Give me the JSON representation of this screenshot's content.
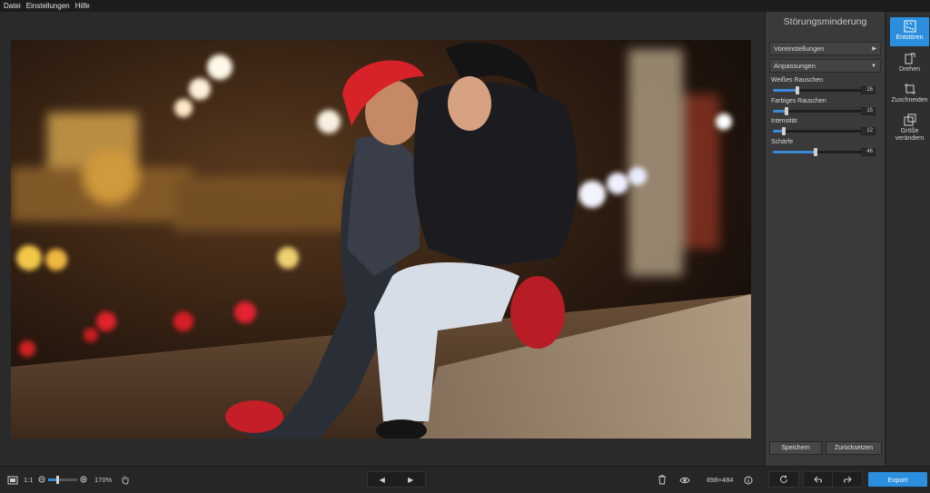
{
  "menu": {
    "file": "Datei",
    "settings": "Einstellungen",
    "help": "Hilfe"
  },
  "panel": {
    "title": "Störungsminderung",
    "presets_label": "Voreinstellungen",
    "adjust_label": "Anpassungen",
    "sliders": [
      {
        "label": "Weißes Rauschen",
        "value": "26",
        "level": 0.26
      },
      {
        "label": "Farbiges Rauschen",
        "value": "15",
        "level": 0.15
      },
      {
        "label": "Intensität",
        "value": "12",
        "level": 0.12
      },
      {
        "label": "Schärfe",
        "value": "46",
        "level": 0.46
      }
    ],
    "save_label": "Speichern",
    "reset_label": "Zurücksetzen"
  },
  "tools": [
    {
      "label": "Entstören",
      "icon": "denoise-icon",
      "active": true
    },
    {
      "label": "Drehen",
      "icon": "rotate-icon",
      "active": false
    },
    {
      "label": "Zuschneiden",
      "icon": "crop-icon",
      "active": false
    },
    {
      "label": "Größe verändern",
      "icon": "resize-icon",
      "active": false
    }
  ],
  "bottom": {
    "ratio_label": "1:1",
    "zoom_value": "170%",
    "zoom_level": 0.3,
    "dimensions": "898×484",
    "export_label": "Export"
  },
  "colors": {
    "accent": "#2b8fde",
    "panel": "#3a3a3a",
    "background": "#2a2a2a"
  }
}
